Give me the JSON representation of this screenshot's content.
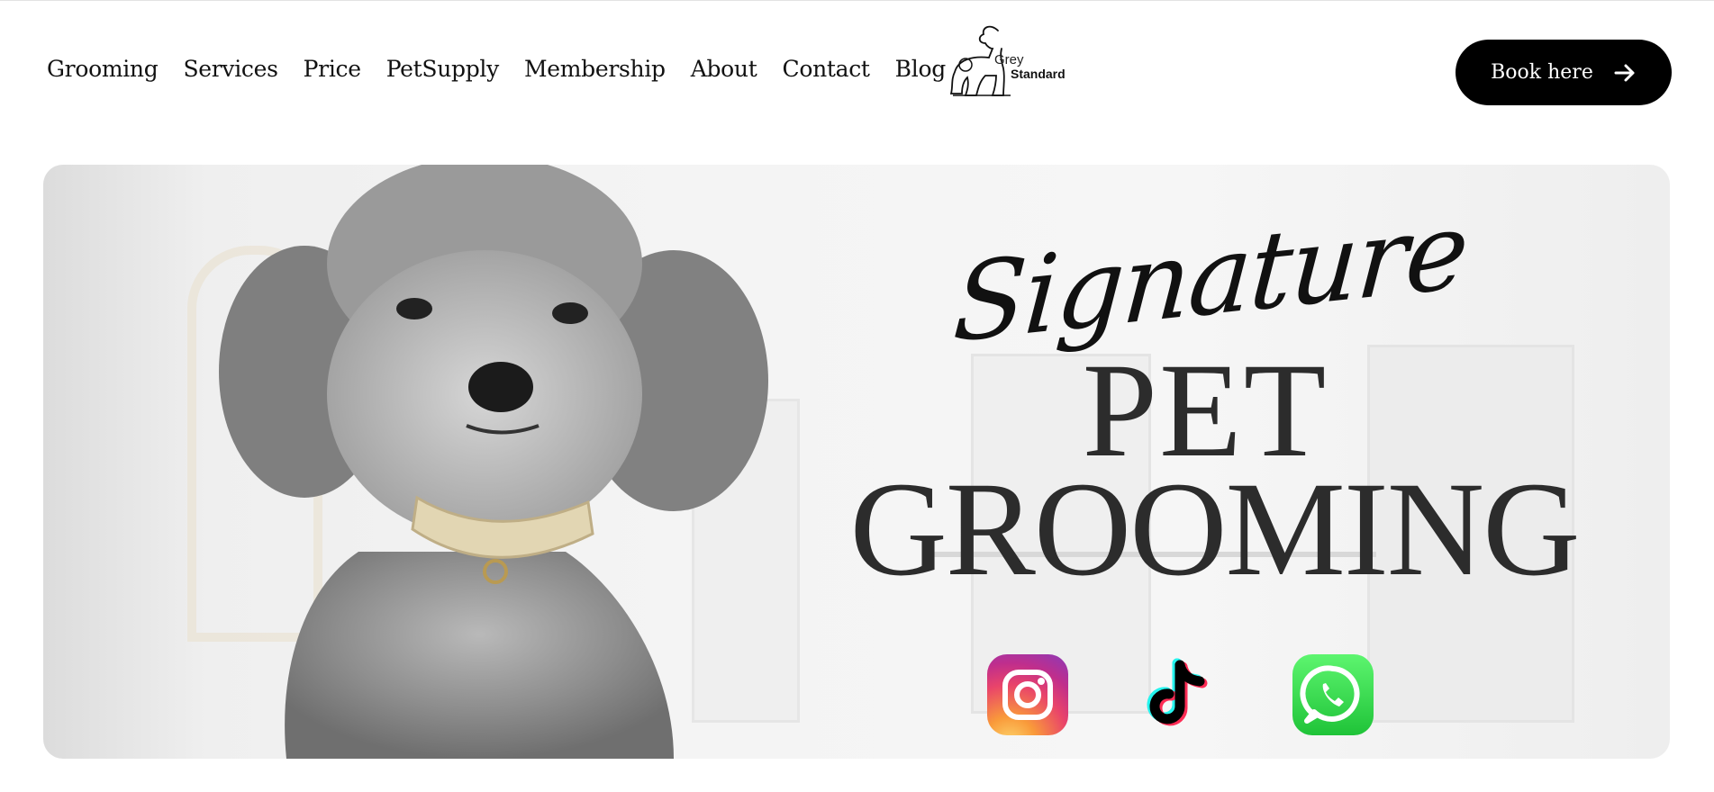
{
  "nav": {
    "items": [
      {
        "label": "Grooming"
      },
      {
        "label": "Services"
      },
      {
        "label": "Price"
      },
      {
        "label": "PetSupply"
      },
      {
        "label": "Membership"
      },
      {
        "label": "About"
      },
      {
        "label": "Contact"
      },
      {
        "label": "Blog"
      }
    ]
  },
  "logo": {
    "line1": "Grey",
    "line2": "Standard",
    "icon": "poodle-logo-icon"
  },
  "cta": {
    "label": "Book here",
    "icon": "arrow-right-icon"
  },
  "hero": {
    "title_script": "Signature",
    "title_line1": "PET",
    "title_line2": "GROOMING",
    "image": "grey-poodle-photo",
    "social": [
      {
        "name": "Instagram",
        "icon": "instagram-icon"
      },
      {
        "name": "TikTok",
        "icon": "tiktok-icon"
      },
      {
        "name": "WhatsApp",
        "icon": "whatsapp-icon"
      }
    ]
  },
  "colors": {
    "button_bg": "#000000",
    "text": "#111111",
    "hero_bg": "#f2f2f2",
    "title": "#2c2c2c"
  }
}
